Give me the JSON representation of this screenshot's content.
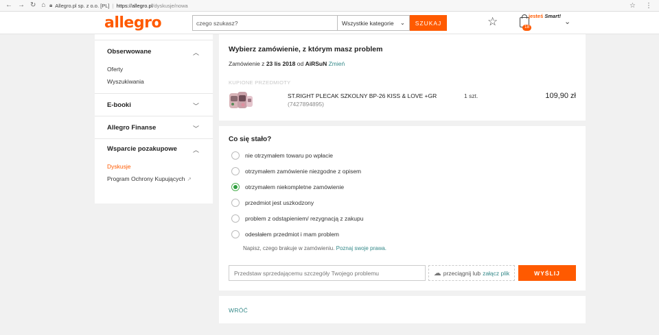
{
  "browser": {
    "owner": "Allegro.pl sp. z o.o. [PL]",
    "host": "https://allegro.pl",
    "path": "/dyskusje/nowa"
  },
  "header": {
    "logo": "allegro",
    "search_placeholder": "czego szukasz?",
    "category": "Wszystkie kategorie",
    "search_button": "SZUKAJ",
    "cart_count": "18",
    "smart_prefix": "jesteś",
    "smart_label": "Smart!"
  },
  "sidebar": {
    "sections": [
      {
        "title": "Obserwowane",
        "items": [
          "Oferty",
          "Wyszukiwania"
        ]
      },
      {
        "title": "E-booki"
      },
      {
        "title": "Allegro Finanse"
      },
      {
        "title": "Wsparcie pozakupowe",
        "items": [
          "Dyskusje",
          "Program Ochrony Kupujących"
        ]
      }
    ]
  },
  "order": {
    "title": "Wybierz zamówienie, z którym masz problem",
    "prefix": "Zamówienie z",
    "date": "23 lis 2018",
    "from": "od",
    "seller": "AiRSuN",
    "change": "Zmień",
    "bought_label": "KUPIONE PRZEDMIOTY",
    "product": {
      "name": "ST.RIGHT PLECAK SZKOLNY BP-26 KISS & LOVE +GR",
      "id": "(7427894895)",
      "qty": "1 szt.",
      "price": "109,90 zł"
    }
  },
  "question": {
    "title": "Co się stało?",
    "options": [
      {
        "label": "nie otrzymałem towaru po wpłacie",
        "checked": false
      },
      {
        "label": "otrzymałem zamówienie niezgodne z opisem",
        "checked": false
      },
      {
        "label": "otrzymałem niekompletne zamówienie",
        "checked": true
      },
      {
        "label": "przedmiot jest uszkodzony",
        "checked": false
      },
      {
        "label": "problem z odstąpieniem/ rezygnacją z zakupu",
        "checked": false
      },
      {
        "label": "odesłałem przedmiot i mam problem",
        "checked": false
      }
    ],
    "hint": "Napisz, czego brakuje w zamówieniu.",
    "hint_link": "Poznaj swoje prawa.",
    "input_placeholder": "Przedstaw sprzedającemu szczegóły Twojego problemu",
    "upload_text": "przeciągnij lub",
    "upload_link": "załącz plik",
    "send_button": "WYŚLIJ"
  },
  "back": {
    "label": "WRÓĆ"
  },
  "colors": {
    "accent": "#ff5a00",
    "link": "#338888",
    "checked": "#2e9e3e"
  }
}
